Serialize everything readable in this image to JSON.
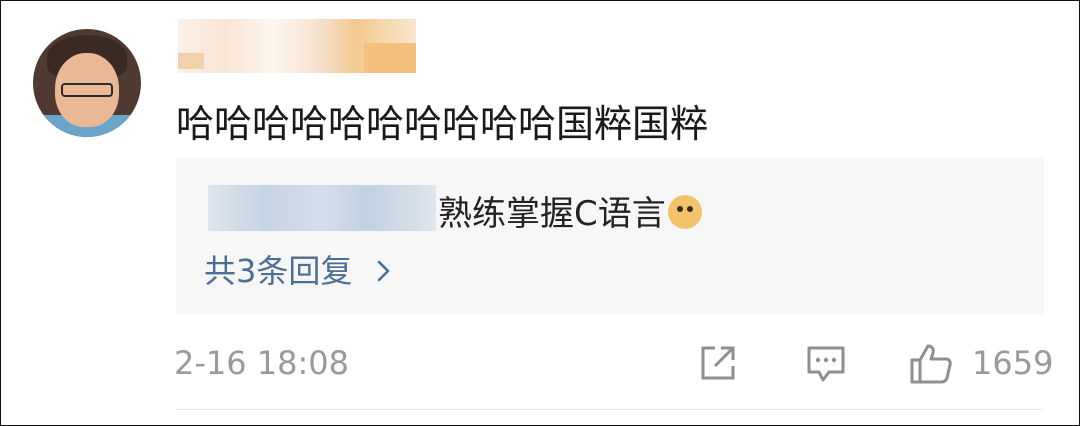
{
  "comment": {
    "text": "哈哈哈哈哈哈哈哈哈哈国粹国粹"
  },
  "reply_preview": {
    "text": "熟练掌握C语言",
    "emoji": "doge-emoji",
    "more_label": "共3条回复"
  },
  "meta": {
    "timestamp": "2-16 18:08",
    "like_count": "1659"
  },
  "icons": {
    "share": "share-icon",
    "comment": "comment-icon",
    "like": "thumbs-up-icon",
    "chevron": "chevron-right-icon"
  },
  "colors": {
    "link": "#4e6f94",
    "muted": "#9a9a9a",
    "reply_bg": "#f7f7f7"
  }
}
